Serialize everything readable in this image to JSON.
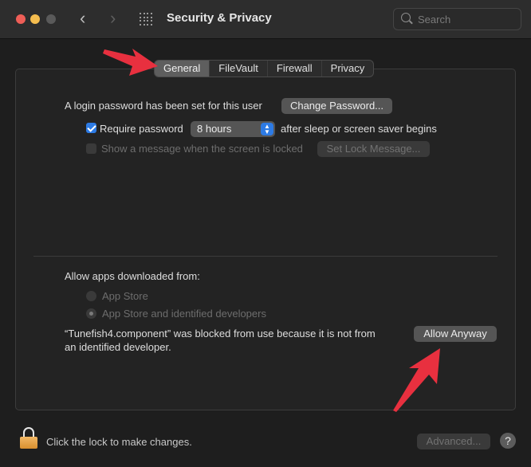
{
  "window": {
    "title": "Security & Privacy",
    "nav_back": "‹",
    "nav_forward": "›"
  },
  "search": {
    "placeholder": "Search",
    "value": ""
  },
  "tabs": [
    {
      "label": "General",
      "active": true
    },
    {
      "label": "FileVault",
      "active": false
    },
    {
      "label": "Firewall",
      "active": false
    },
    {
      "label": "Privacy",
      "active": false
    }
  ],
  "general": {
    "login_text": "A login password has been set for this user",
    "change_password_button": "Change Password...",
    "require_password_label": "Require password",
    "require_password_checked": true,
    "require_password_interval": "8 hours",
    "after_sleep_text": "after sleep or screen saver begins",
    "show_message_label": "Show a message when the screen is locked",
    "show_message_checked": false,
    "set_lock_message_button": "Set Lock Message...",
    "allow_apps_label": "Allow apps downloaded from:",
    "radio_options": [
      {
        "label": "App Store",
        "selected": false
      },
      {
        "label": "App Store and identified developers",
        "selected": true
      }
    ],
    "blocked_line1": "“Tunefish4.component” was blocked from use because it is not from",
    "blocked_line2": "an identified developer.",
    "allow_anyway_button": "Allow Anyway"
  },
  "footer": {
    "lock_text": "Click the lock to make changes.",
    "advanced_button": "Advanced...",
    "help_button": "?"
  },
  "annotations": {
    "arrow_color": "#e8303f"
  }
}
